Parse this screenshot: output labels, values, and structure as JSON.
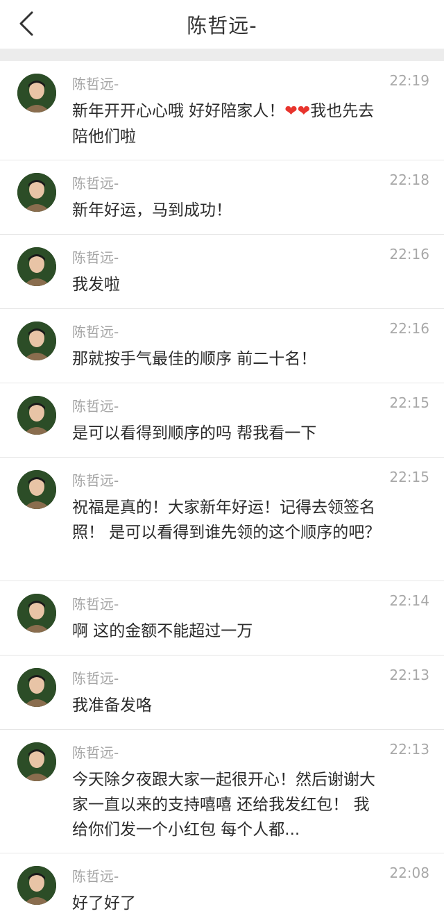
{
  "header": {
    "title": "陈哲远-",
    "back_icon": "chevron-left-icon"
  },
  "messages": [
    {
      "name": "陈哲远-",
      "time": "22:19",
      "text_before": "新年开开心心哦 好好陪家人！",
      "hearts": "❤❤",
      "text_after": "我也先去陪他们啦"
    },
    {
      "name": "陈哲远-",
      "time": "22:18",
      "text": "新年好运，马到成功！"
    },
    {
      "name": "陈哲远-",
      "time": "22:16",
      "text": "我发啦"
    },
    {
      "name": "陈哲远-",
      "time": "22:16",
      "text": "那就按手气最佳的顺序 前二十名！"
    },
    {
      "name": "陈哲远-",
      "time": "22:15",
      "text": "是可以看得到顺序的吗 帮我看一下"
    },
    {
      "name": "陈哲远-",
      "time": "22:15",
      "text": "祝福是真的！大家新年好运！记得去领签名照！ 是可以看得到谁先领的这个顺序的吧？"
    },
    {
      "name": "陈哲远-",
      "time": "22:14",
      "text": "啊 这的金额不能超过一万"
    },
    {
      "name": "陈哲远-",
      "time": "22:13",
      "text": "我准备发咯"
    },
    {
      "name": "陈哲远-",
      "time": "22:13",
      "text": "今天除夕夜跟大家一起很开心！然后谢谢大家一直以来的支持嘻嘻 还给我发红包！ 我给你们发一个小红包 每个人都..."
    },
    {
      "name": "陈哲远-",
      "time": "22:08",
      "text": "好了好了"
    }
  ],
  "colors": {
    "heart": "#e8342d",
    "name_gray": "#a3a3a3",
    "band_gray": "#ececec"
  }
}
